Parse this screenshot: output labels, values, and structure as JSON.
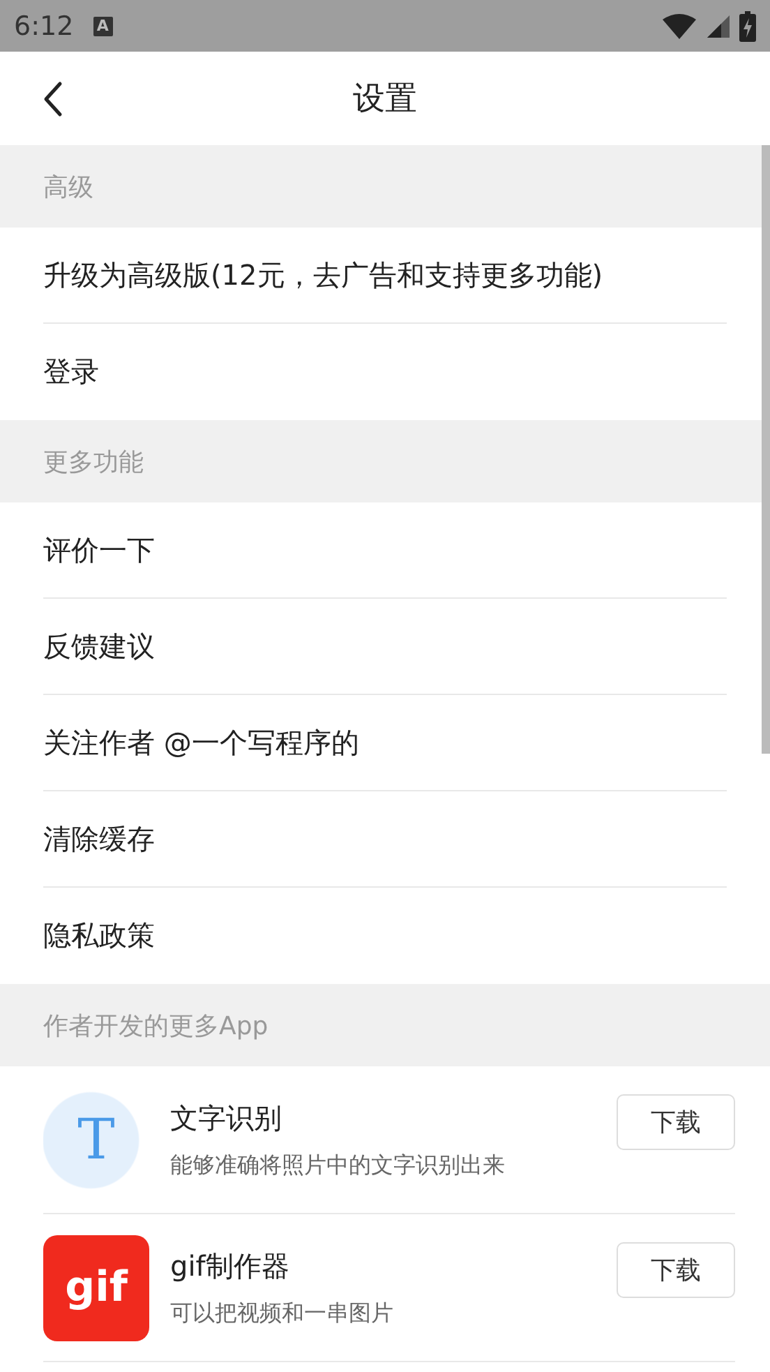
{
  "status_bar": {
    "time": "6:12",
    "notification": "A"
  },
  "header": {
    "title": "设置"
  },
  "sections": [
    {
      "title": "高级",
      "items": [
        "升级为高级版(12元，去广告和支持更多功能)",
        "登录"
      ]
    },
    {
      "title": "更多功能",
      "items": [
        "评价一下",
        "反馈建议",
        "关注作者 @一个写程序的",
        "清除缓存",
        "隐私政策"
      ]
    },
    {
      "title": "作者开发的更多App",
      "apps": [
        {
          "kind": "text",
          "name": "文字识别",
          "description": "能够准确将照片中的文字识别出来",
          "button": "下载",
          "icon_text": "T"
        },
        {
          "kind": "gif",
          "name": "gif制作器",
          "description": "可以把视频和一串图片",
          "button": "下载",
          "icon_text": "gif"
        }
      ]
    }
  ]
}
